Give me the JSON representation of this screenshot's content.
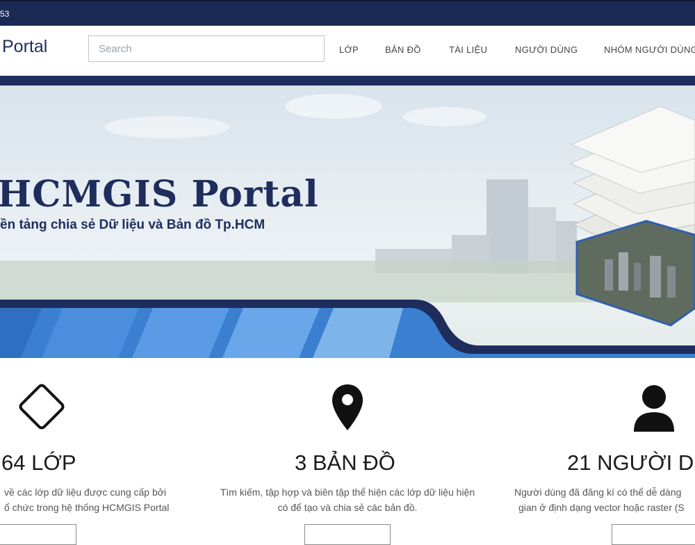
{
  "topbar": {
    "number_text": "53"
  },
  "header": {
    "brand": "Portal",
    "search_placeholder": "Search",
    "nav": [
      {
        "label": "LỚP"
      },
      {
        "label": "BẢN ĐỒ"
      },
      {
        "label": "TÀI LIỆU"
      },
      {
        "label": "NGƯỜI DÙNG"
      },
      {
        "label": "NHÓM NGƯỜI DÙNG"
      }
    ]
  },
  "hero": {
    "title": "HCMGIS Portal",
    "subtitle": "ền tảng chia sẻ Dữ liệu và Bản đồ Tp.HCM"
  },
  "features": [
    {
      "icon": "layers-diamond-icon",
      "count": "64 LỚP",
      "desc_line1": "về các lớp dữ liệu được cung cấp bởi",
      "desc_line2": "ổ chức trong hệ thống HCMGIS Portal"
    },
    {
      "icon": "map-pin-icon",
      "count": "3 BẢN ĐỒ",
      "desc_line1": "Tìm kiếm, tập hợp và biên tập thể hiện các lớp dữ liệu hiện",
      "desc_line2": "có để tạo và chia sẻ các bản đồ."
    },
    {
      "icon": "user-icon",
      "count": "21 NGƯỜI D",
      "desc_line1": "Người dùng đã đăng kí có thể dễ dàng",
      "desc_line2": "gian ở định dạng vector hoặc raster (S"
    }
  ],
  "colors": {
    "navy": "#1e2d5c",
    "accent_blue": "#3a7fd0",
    "light_blue": "#7db4ea"
  }
}
